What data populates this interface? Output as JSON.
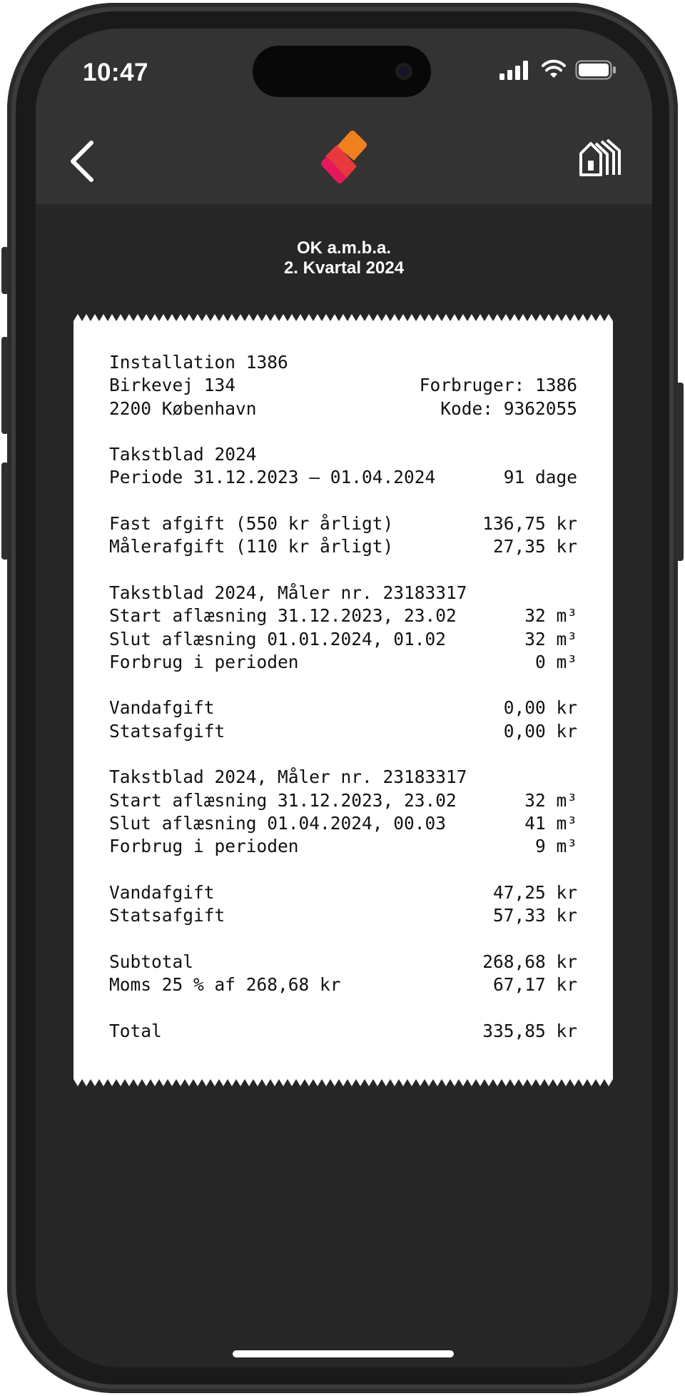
{
  "status_bar": {
    "time": "10:47"
  },
  "header": {
    "company": "OK a.m.b.a.",
    "period": "2. Kvartal 2024"
  },
  "colors": {
    "accent_orange": "#f0801e",
    "accent_red": "#e4185a",
    "background": "#262626",
    "topbar": "#333333"
  },
  "icons": {
    "back": "chevron-left-icon",
    "logo": "app-logo-icon",
    "home": "houses-icon"
  },
  "receipt": {
    "installation": "Installation 1386",
    "address_line1": "Birkevej 134",
    "consumer": "Forbruger: 1386",
    "address_line2": "2200 København",
    "code": "Kode: 9362055",
    "tariff": "Takstblad 2024",
    "period_label": "Periode 31.12.2023 – 01.04.2024",
    "period_days": "91 dage",
    "fixed_fee_label": "Fast afgift (550 kr årligt)",
    "fixed_fee_value": "136,75 kr",
    "meter_fee_label": "Målerafgift (110 kr årligt)",
    "meter_fee_value": "27,35 kr",
    "meters": [
      {
        "title": "Takstblad 2024, Måler nr. 23183317",
        "start_label": "Start aflæsning 31.12.2023, 23.02",
        "start_value": "32 m³",
        "end_label": "Slut aflæsning 01.01.2024, 01.02",
        "end_value": "32 m³",
        "usage_label": "Forbrug i perioden",
        "usage_value": "0 m³",
        "water_label": "Vandafgift",
        "water_value": "0,00 kr",
        "state_label": "Statsafgift",
        "state_value": "0,00 kr"
      },
      {
        "title": "Takstblad 2024, Måler nr. 23183317",
        "start_label": "Start aflæsning 31.12.2023, 23.02",
        "start_value": "32 m³",
        "end_label": "Slut aflæsning 01.04.2024, 00.03",
        "end_value": "41 m³",
        "usage_label": "Forbrug i perioden",
        "usage_value": "9 m³",
        "water_label": "Vandafgift",
        "water_value": "47,25 kr",
        "state_label": "Statsafgift",
        "state_value": "57,33 kr"
      }
    ],
    "subtotal_label": "Subtotal",
    "subtotal_value": "268,68 kr",
    "vat_label": "Moms 25 % af 268,68 kr",
    "vat_value": "67,17 kr",
    "total_label": "Total",
    "total_value": "335,85 kr"
  }
}
